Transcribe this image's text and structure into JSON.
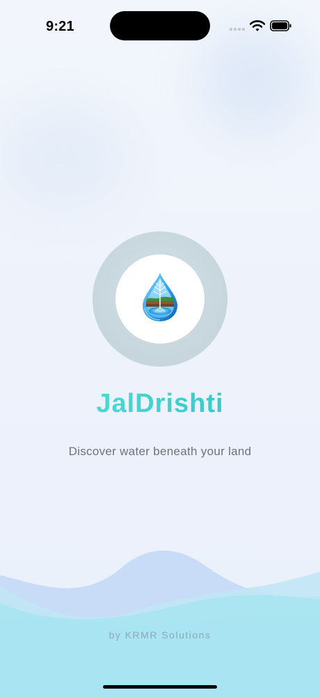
{
  "status_bar": {
    "time": "9:21"
  },
  "app": {
    "title": "JalDrishti",
    "tagline": "Discover water beneath your land",
    "credit": "by KRMR Solutions"
  },
  "icons": {
    "logo": "water-drop-logo-icon",
    "signal": "cellular-signal-icon",
    "wifi": "wifi-icon",
    "battery": "battery-icon"
  },
  "colors": {
    "title_gradient_start": "#5fe0da",
    "title_gradient_end": "#22c2c8",
    "tagline": "#6b7280",
    "wave_front": "#a8e4f2",
    "wave_back": "#c9dcf7"
  }
}
